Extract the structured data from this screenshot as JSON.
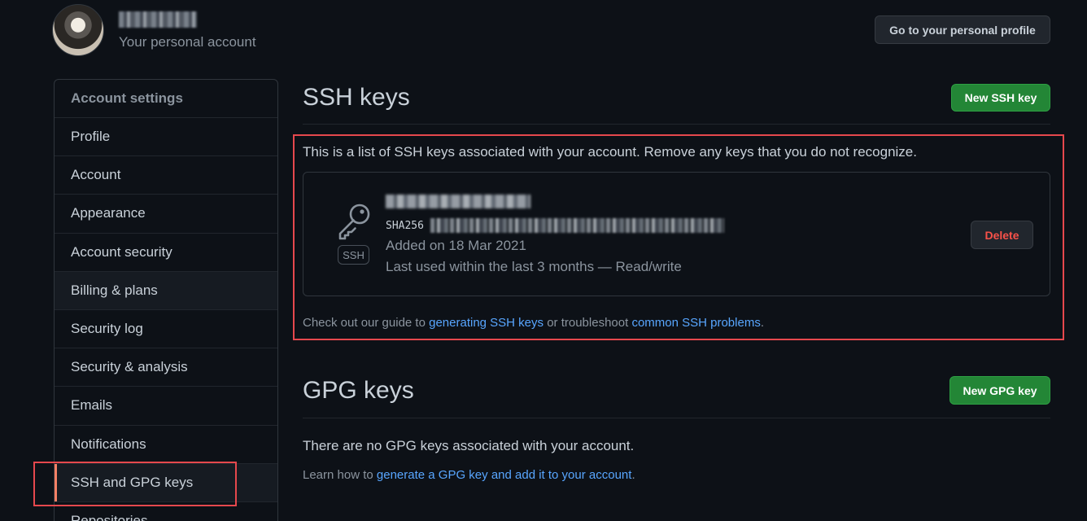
{
  "header": {
    "account_subtitle": "Your personal account",
    "profile_button": "Go to your personal profile"
  },
  "sidebar": {
    "heading": "Account settings",
    "items": [
      {
        "label": "Profile"
      },
      {
        "label": "Account"
      },
      {
        "label": "Appearance"
      },
      {
        "label": "Account security"
      },
      {
        "label": "Billing & plans"
      },
      {
        "label": "Security log"
      },
      {
        "label": "Security & analysis"
      },
      {
        "label": "Emails"
      },
      {
        "label": "Notifications"
      },
      {
        "label": "SSH and GPG keys"
      },
      {
        "label": "Repositories"
      }
    ],
    "active_item": "SSH and GPG keys"
  },
  "ssh": {
    "title": "SSH keys",
    "new_button": "New SSH key",
    "intro": "This is a list of SSH keys associated with your account. Remove any keys that you do not recognize.",
    "key": {
      "badge": "SSH",
      "fingerprint_prefix": "SHA256",
      "added": "Added on 18 Mar 2021",
      "last_used": "Last used within the last 3 months — Read/write",
      "delete_button": "Delete"
    },
    "guide_prefix": "Check out our guide to ",
    "guide_link1": "generating SSH keys",
    "guide_middle": " or troubleshoot ",
    "guide_link2": "common SSH problems",
    "guide_suffix": "."
  },
  "gpg": {
    "title": "GPG keys",
    "new_button": "New GPG key",
    "empty": "There are no GPG keys associated with your account.",
    "learn_prefix": "Learn how to ",
    "learn_link": "generate a GPG key and add it to your account",
    "learn_suffix": "."
  },
  "colors": {
    "background": "#0d1117",
    "accent_link": "#58a6ff",
    "primary_button": "#238636",
    "danger": "#f85149",
    "active_indicator": "#f78166",
    "annotation_box": "#e5484d"
  },
  "icons": {
    "key": "key-icon"
  }
}
